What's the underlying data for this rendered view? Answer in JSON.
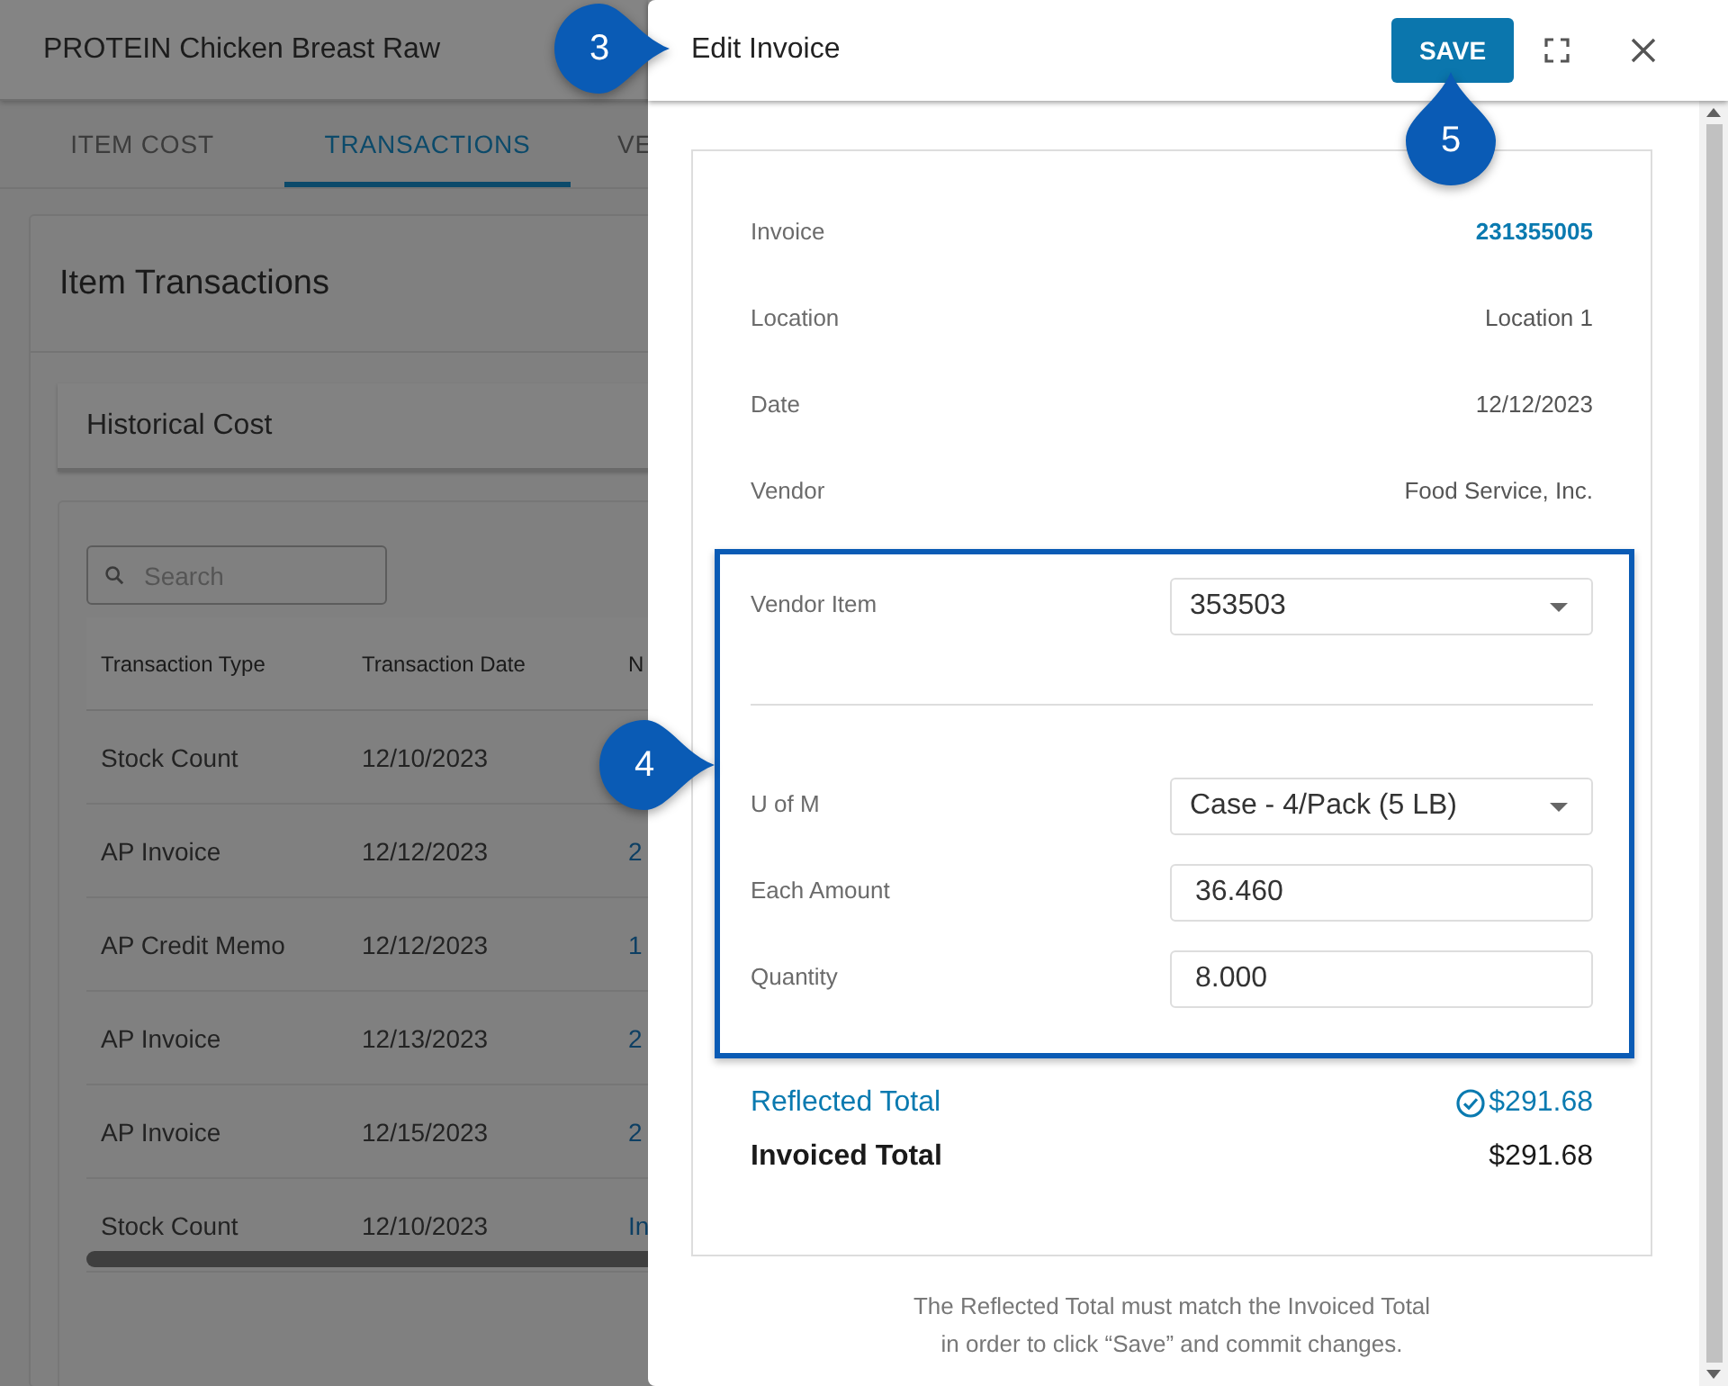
{
  "background_page": {
    "title": "PROTEIN Chicken Breast Raw",
    "tabs": [
      {
        "label": "ITEM COST",
        "selected": false
      },
      {
        "label": "TRANSACTIONS",
        "selected": true
      },
      {
        "label": "VE",
        "selected": false
      }
    ],
    "section_title": "Item Transactions",
    "subsection_title": "Historical Cost",
    "search": {
      "placeholder": "Search"
    },
    "table": {
      "columns": [
        "Transaction Type",
        "Transaction Date",
        "N"
      ],
      "rows": [
        [
          "Stock Count",
          "12/10/2023",
          ""
        ],
        [
          "AP Invoice",
          "12/12/2023",
          "2"
        ],
        [
          "AP Credit Memo",
          "12/12/2023",
          "1"
        ],
        [
          "AP Invoice",
          "12/13/2023",
          "2"
        ],
        [
          "AP Invoice",
          "12/15/2023",
          "2"
        ],
        [
          "Stock Count",
          "12/10/2023",
          "In"
        ]
      ]
    }
  },
  "dialog": {
    "title": "Edit Invoice",
    "save_button": "SAVE",
    "details": [
      {
        "label": "Invoice",
        "value": "231355005",
        "kind": "link"
      },
      {
        "label": "Location",
        "value": "Location 1",
        "kind": "text"
      },
      {
        "label": "Date",
        "value": "12/12/2023",
        "kind": "text"
      },
      {
        "label": "Vendor",
        "value": "Food Service, Inc.",
        "kind": "text"
      }
    ],
    "item_fields": [
      {
        "label": "Vendor Item",
        "value": "353503",
        "kind": "select"
      }
    ],
    "amount_fields": [
      {
        "label": "U of M",
        "value": "Case - 4/Pack (5 LB)",
        "kind": "select"
      },
      {
        "label": "Each Amount",
        "value": "36.460",
        "kind": "input"
      },
      {
        "label": "Quantity",
        "value": "8.000",
        "kind": "input"
      }
    ],
    "reflected_total": {
      "label": "Reflected Total",
      "value": "$291.68",
      "matched": true
    },
    "invoiced_total": {
      "label": "Invoiced Total",
      "value": "$291.68"
    },
    "note": "The Reflected Total must match the Invoiced Total in order to click “Save” and commit changes."
  },
  "callouts": [
    {
      "number": "3"
    },
    {
      "number": "4"
    },
    {
      "number": "5"
    }
  ]
}
